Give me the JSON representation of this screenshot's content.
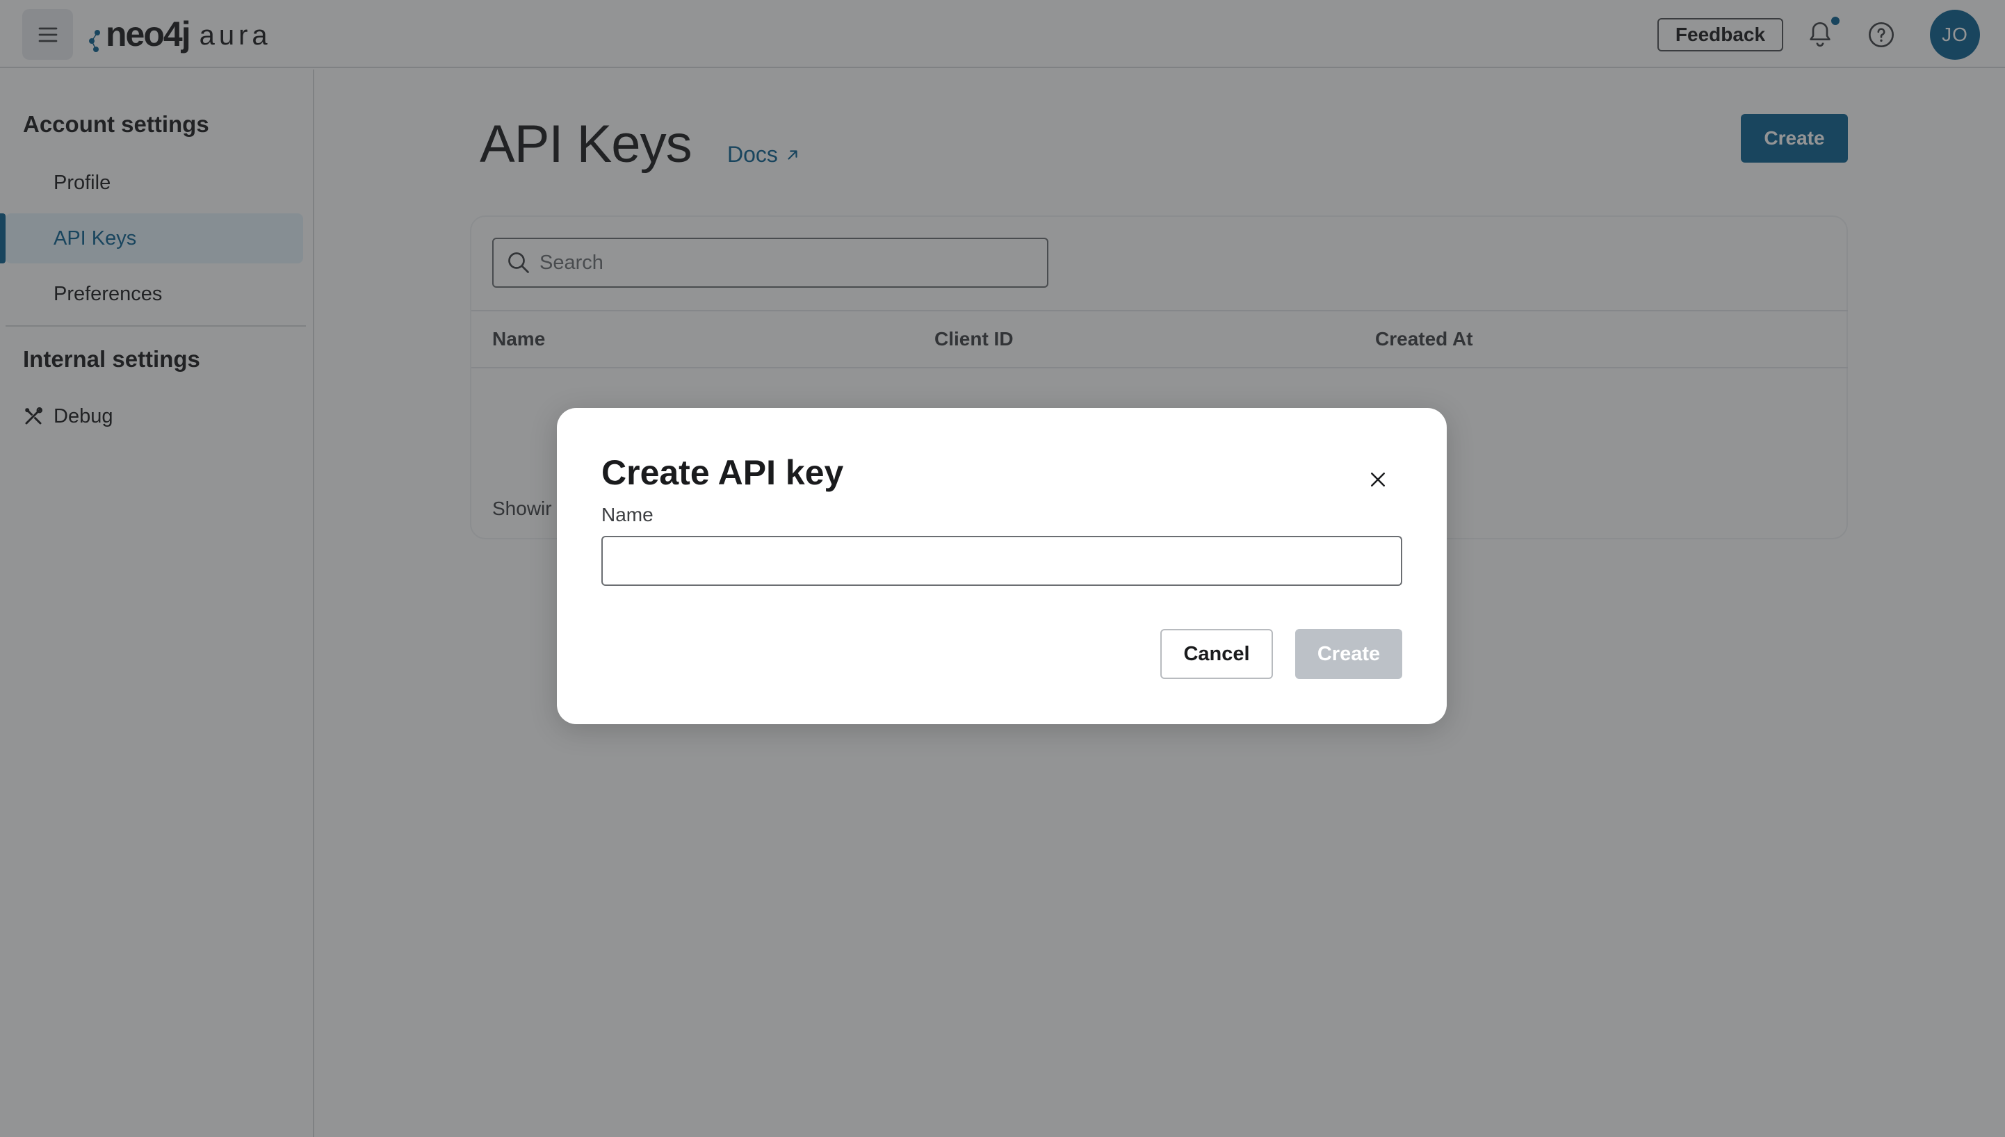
{
  "topbar": {
    "logo_main": "neo4j",
    "logo_sub": "aura",
    "feedback_label": "Feedback",
    "avatar_initials": "JO"
  },
  "sidebar": {
    "account_heading": "Account settings",
    "account_items": [
      {
        "label": "Profile",
        "active": false
      },
      {
        "label": "API Keys",
        "active": true
      },
      {
        "label": "Preferences",
        "active": false
      }
    ],
    "internal_heading": "Internal settings",
    "internal_items": [
      {
        "label": "Debug",
        "icon": "tools-icon"
      }
    ]
  },
  "main": {
    "title": "API Keys",
    "docs_label": "Docs",
    "create_label": "Create",
    "search_placeholder": "Search",
    "columns": [
      "Name",
      "Client ID",
      "Created At"
    ],
    "footer_text_visible": "Showir"
  },
  "modal": {
    "title": "Create API key",
    "name_label": "Name",
    "name_value": "",
    "cancel_label": "Cancel",
    "create_label": "Create"
  },
  "colors": {
    "accent": "#0a6190",
    "overlay": "rgba(40,42,44,0.50)",
    "disabled_button": "#bcc1c7"
  }
}
